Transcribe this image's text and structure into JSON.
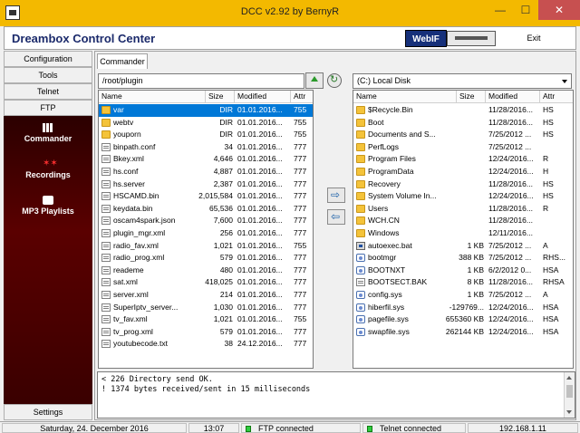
{
  "window": {
    "title": "DCC v2.92 by BernyR",
    "minimize": "—",
    "maximize": "☐",
    "close": "✕"
  },
  "header": {
    "title": "Dreambox Control Center",
    "logo_text": "WebIF",
    "exit_label": "Exit"
  },
  "sidebar": {
    "top_buttons": [
      "Configuration",
      "Tools",
      "Telnet",
      "FTP"
    ],
    "panel_items": [
      {
        "label": "Commander",
        "icon": "grid-icon"
      },
      {
        "label": "Recordings",
        "icon": "stars-icon"
      },
      {
        "label": "MP3 Playlists",
        "icon": "music-icon"
      }
    ],
    "settings_label": "Settings"
  },
  "tabs": [
    {
      "label": "Commander"
    }
  ],
  "left_pane": {
    "path": "/root/plugin",
    "columns": [
      "Name",
      "Size",
      "Modified",
      "Attr"
    ],
    "rows": [
      {
        "name": "var",
        "size": "DIR",
        "modified": "01.01.2016...",
        "attr": "755",
        "type": "folder",
        "selected": true
      },
      {
        "name": "webtv",
        "size": "DIR",
        "modified": "01.01.2016...",
        "attr": "755",
        "type": "folder"
      },
      {
        "name": "youporn",
        "size": "DIR",
        "modified": "01.01.2016...",
        "attr": "755",
        "type": "folder"
      },
      {
        "name": "binpath.conf",
        "size": "34",
        "modified": "01.01.2016...",
        "attr": "777",
        "type": "file"
      },
      {
        "name": "Bkey.xml",
        "size": "4,646",
        "modified": "01.01.2016...",
        "attr": "777",
        "type": "file"
      },
      {
        "name": "hs.conf",
        "size": "4,887",
        "modified": "01.01.2016...",
        "attr": "777",
        "type": "file"
      },
      {
        "name": "hs.server",
        "size": "2,387",
        "modified": "01.01.2016...",
        "attr": "777",
        "type": "file"
      },
      {
        "name": "HSCAMD.bin",
        "size": "2,015,584",
        "modified": "01.01.2016...",
        "attr": "777",
        "type": "file"
      },
      {
        "name": "keydata.bin",
        "size": "65,536",
        "modified": "01.01.2016...",
        "attr": "777",
        "type": "file"
      },
      {
        "name": "oscam4spark.json",
        "size": "7,600",
        "modified": "01.01.2016...",
        "attr": "777",
        "type": "file"
      },
      {
        "name": "plugin_mgr.xml",
        "size": "256",
        "modified": "01.01.2016...",
        "attr": "777",
        "type": "file"
      },
      {
        "name": "radio_fav.xml",
        "size": "1,021",
        "modified": "01.01.2016...",
        "attr": "755",
        "type": "file"
      },
      {
        "name": "radio_prog.xml",
        "size": "579",
        "modified": "01.01.2016...",
        "attr": "777",
        "type": "file"
      },
      {
        "name": "reademe",
        "size": "480",
        "modified": "01.01.2016...",
        "attr": "777",
        "type": "file"
      },
      {
        "name": "sat.xml",
        "size": "418,025",
        "modified": "01.01.2016...",
        "attr": "777",
        "type": "file"
      },
      {
        "name": "server.xml",
        "size": "214",
        "modified": "01.01.2016...",
        "attr": "777",
        "type": "file"
      },
      {
        "name": "SuperIptv_server...",
        "size": "1,030",
        "modified": "01.01.2016...",
        "attr": "777",
        "type": "file"
      },
      {
        "name": "tv_fav.xml",
        "size": "1,021",
        "modified": "01.01.2016...",
        "attr": "755",
        "type": "file"
      },
      {
        "name": "tv_prog.xml",
        "size": "579",
        "modified": "01.01.2016...",
        "attr": "777",
        "type": "file"
      },
      {
        "name": "youtubecode.txt",
        "size": "38",
        "modified": "24.12.2016...",
        "attr": "777",
        "type": "file"
      }
    ]
  },
  "right_pane": {
    "drive": "(C:)  Local Disk",
    "columns": [
      "Name",
      "Size",
      "Modified",
      "Attr"
    ],
    "rows": [
      {
        "name": "$Recycle.Bin",
        "size": "",
        "modified": "11/28/2016...",
        "attr": "HS",
        "type": "folder"
      },
      {
        "name": "Boot",
        "size": "",
        "modified": "11/28/2016...",
        "attr": "HS",
        "type": "folder"
      },
      {
        "name": "Documents and S...",
        "size": "",
        "modified": "7/25/2012 ...",
        "attr": "HS",
        "type": "folder"
      },
      {
        "name": "PerfLogs",
        "size": "",
        "modified": "7/25/2012 ...",
        "attr": "",
        "type": "folder"
      },
      {
        "name": "Program Files",
        "size": "",
        "modified": "12/24/2016...",
        "attr": "R",
        "type": "folder"
      },
      {
        "name": "ProgramData",
        "size": "",
        "modified": "12/24/2016...",
        "attr": "H",
        "type": "folder"
      },
      {
        "name": "Recovery",
        "size": "",
        "modified": "11/28/2016...",
        "attr": "HS",
        "type": "folder"
      },
      {
        "name": "System Volume In...",
        "size": "",
        "modified": "12/24/2016...",
        "attr": "HS",
        "type": "folder"
      },
      {
        "name": "Users",
        "size": "",
        "modified": "11/28/2016...",
        "attr": "R",
        "type": "folder"
      },
      {
        "name": "WCH.CN",
        "size": "",
        "modified": "11/28/2016...",
        "attr": "",
        "type": "folder"
      },
      {
        "name": "Windows",
        "size": "",
        "modified": "12/11/2016...",
        "attr": "",
        "type": "folder"
      },
      {
        "name": "autoexec.bat",
        "size": "1 KB",
        "modified": "7/25/2012 ...",
        "attr": "A",
        "type": "bat"
      },
      {
        "name": "bootmgr",
        "size": "388 KB",
        "modified": "7/25/2012 ...",
        "attr": "RHS...",
        "type": "sys"
      },
      {
        "name": "BOOTNXT",
        "size": "1 KB",
        "modified": "6/2/2012 0...",
        "attr": "HSA",
        "type": "sys"
      },
      {
        "name": "BOOTSECT.BAK",
        "size": "8 KB",
        "modified": "11/28/2016...",
        "attr": "RHSA",
        "type": "file"
      },
      {
        "name": "config.sys",
        "size": "1 KB",
        "modified": "7/25/2012 ...",
        "attr": "A",
        "type": "sys"
      },
      {
        "name": "hiberfil.sys",
        "size": "-129769...",
        "modified": "12/24/2016...",
        "attr": "HSA",
        "type": "sys"
      },
      {
        "name": "pagefile.sys",
        "size": "655360 KB",
        "modified": "12/24/2016...",
        "attr": "HSA",
        "type": "sys"
      },
      {
        "name": "swapfile.sys",
        "size": "262144 KB",
        "modified": "12/24/2016...",
        "attr": "HSA",
        "type": "sys"
      }
    ]
  },
  "log": {
    "lines": [
      "< 226 Directory send OK.",
      "! 1374 bytes received/sent in 15 milliseconds"
    ]
  },
  "status": {
    "date": "Saturday, 24. December 2016",
    "time": "13:07",
    "ftp": "FTP connected",
    "telnet": "Telnet connected",
    "ip": "192.168.1.11"
  },
  "colors": {
    "titlebar": "#f3b900",
    "selection": "#0078d7",
    "sidepanel": "#4a0000",
    "led": "#2ecc40"
  }
}
